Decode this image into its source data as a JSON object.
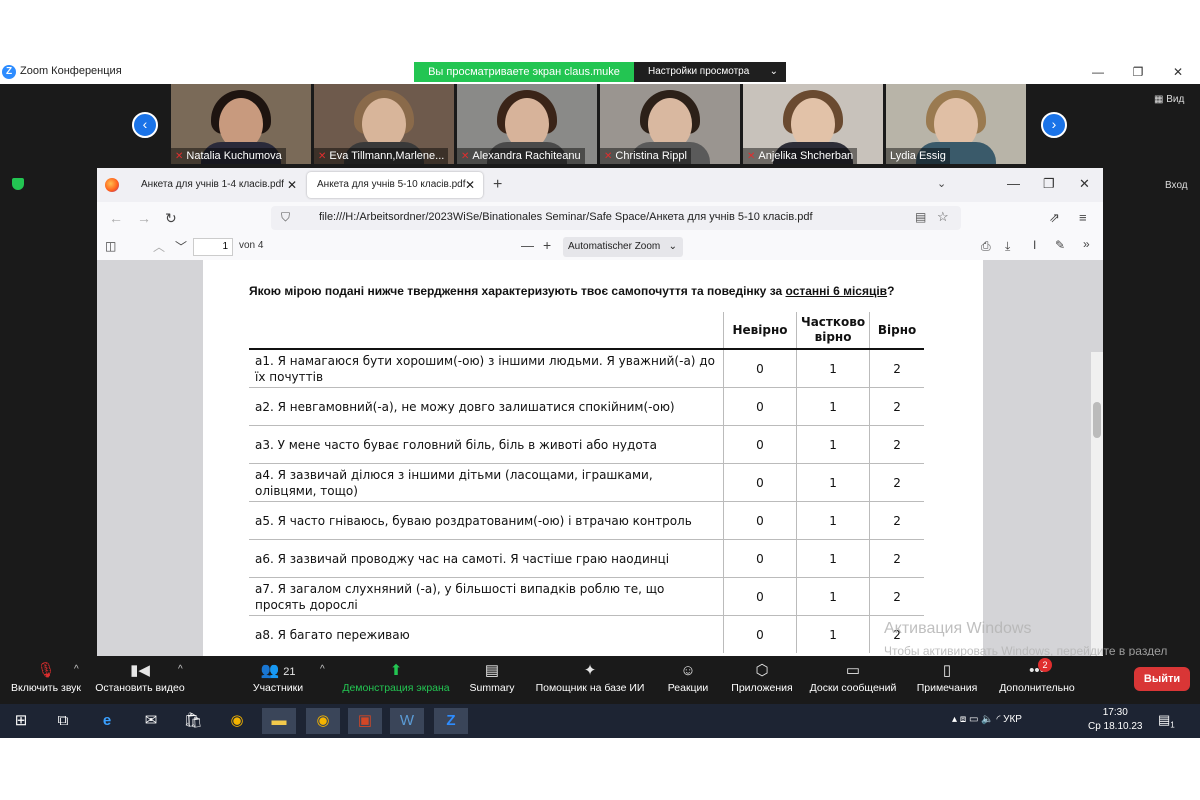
{
  "zoom": {
    "title": "Zoom Конференция",
    "share_banner": "Вы просматриваете экран claus.muke",
    "view_settings": "Настройки просмотра",
    "view_button": "Вид",
    "enter_button": "Вход",
    "participants": [
      {
        "name": "Natalia Kuchumova",
        "muted": true
      },
      {
        "name": "Eva Tillmann,Marlene...",
        "muted": true
      },
      {
        "name": "Alexandra Rachiteanu",
        "muted": true
      },
      {
        "name": "Christina Rippl",
        "muted": true
      },
      {
        "name": "Anjelika Shcherban",
        "muted": true
      },
      {
        "name": "Lydia Essig",
        "muted": false
      }
    ],
    "toolbar": [
      {
        "label": "Включить звук",
        "icon": "microphone-muted-icon",
        "glyph": "🎙"
      },
      {
        "label": "Остановить видео",
        "icon": "video-camera-icon",
        "glyph": "▮◀"
      },
      {
        "label": "Участники",
        "icon": "participants-icon",
        "glyph": "👥",
        "count": "21"
      },
      {
        "label": "Демонстрация экрана",
        "icon": "share-screen-icon",
        "glyph": "⬆"
      },
      {
        "label": "Summary",
        "icon": "summary-icon",
        "glyph": "▤"
      },
      {
        "label": "Помощник на базе ИИ",
        "icon": "ai-assistant-icon",
        "glyph": "✦"
      },
      {
        "label": "Реакции",
        "icon": "reactions-icon",
        "glyph": "☺"
      },
      {
        "label": "Приложения",
        "icon": "apps-icon",
        "glyph": "⬡"
      },
      {
        "label": "Доски сообщений",
        "icon": "whiteboard-icon",
        "glyph": "▭"
      },
      {
        "label": "Примечания",
        "icon": "notes-icon",
        "glyph": "▯"
      },
      {
        "label": "Дополнительно",
        "icon": "more-icon",
        "glyph": "•••"
      }
    ],
    "more_badge": "2",
    "leave_label": "Выйти"
  },
  "browser": {
    "tabs": [
      {
        "label": "Анкета для учнів 1-4 класів.pdf"
      },
      {
        "label": "Анкета для учнів 5-10 класів.pdf"
      }
    ],
    "url": "file:///H:/Arbeitsordner/2023WiSe/Binationales Seminar/Safe Space/Анкета для учнів 5-10 класів.pdf",
    "pdf": {
      "page": "1",
      "of": "von 4",
      "zoom": "Automatischer Zoom"
    }
  },
  "document": {
    "heading_prefix": "Якою мірою подані нижче твердження характеризують твоє самопочуття та поведінку за ",
    "heading_underlined": "останні 6 місяців",
    "heading_suffix": "?",
    "columns": [
      "Невірно",
      "Частково вірно",
      "Вірно"
    ],
    "rows": [
      {
        "q": "а1. Я намагаюся бути хорошим(-ою) з іншими людьми. Я уважний(-а) до їх почуттів",
        "v": [
          "0",
          "1",
          "2"
        ]
      },
      {
        "q": "а2. Я невгамовний(-а), не можу довго залишатися спокійним(-ою)",
        "v": [
          "0",
          "1",
          "2"
        ]
      },
      {
        "q": "а3. У мене часто буває головний біль, біль в животі або нудота",
        "v": [
          "0",
          "1",
          "2"
        ]
      },
      {
        "q": "а4. Я зазвичай ділюся з іншими дітьми (ласощами, іграшками, олівцями, тощо)",
        "v": [
          "0",
          "1",
          "2"
        ]
      },
      {
        "q": "а5. Я часто гніваюсь, буваю роздратованим(-ою) і втрачаю контроль",
        "v": [
          "0",
          "1",
          "2"
        ]
      },
      {
        "q": "а6. Я зазвичай проводжу час на самоті. Я частіше граю наодинці",
        "v": [
          "0",
          "1",
          "2"
        ]
      },
      {
        "q": "а7. Я загалом слухняний (-а), у більшості випадків роблю те, що просять дорослі",
        "v": [
          "0",
          "1",
          "2"
        ]
      },
      {
        "q": "а8. Я багато переживаю",
        "v": [
          "0",
          "1",
          "2"
        ]
      }
    ]
  },
  "windows_activation": {
    "title": "Активация Windows",
    "text": "Чтобы активировать Windows, перейдите в раздел \"Параметры\"."
  },
  "taskbar": {
    "language": "УКР",
    "time": "17:30",
    "date": "Ср 18.10.23",
    "notification_count": "1"
  }
}
